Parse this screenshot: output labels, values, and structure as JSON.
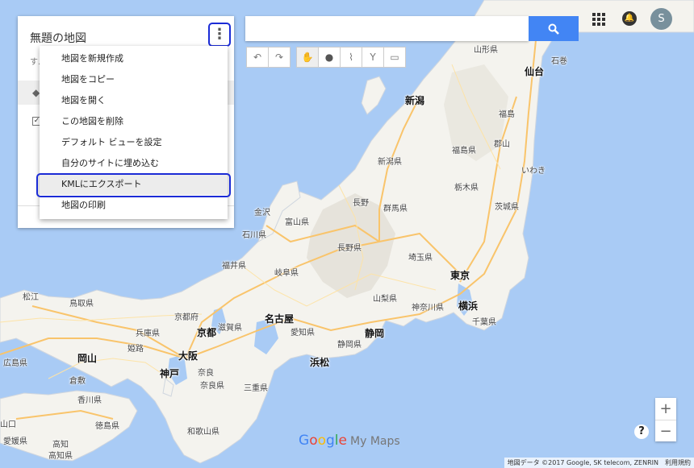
{
  "panel": {
    "title": "無題の地図",
    "subline": "す…"
  },
  "menu": {
    "items": [
      "地図を新規作成",
      "地図をコピー",
      "地図を開く",
      "この地図を削除",
      "デフォルト ビューを設定",
      "自分のサイトに埋め込む",
      "KMLにエクスポート",
      "地図の印刷"
    ],
    "selected_index": 6
  },
  "search": {
    "placeholder": ""
  },
  "avatar": {
    "initial": "S"
  },
  "zoom": {
    "in": "+",
    "out": "−"
  },
  "help": "?",
  "logo": {
    "google": [
      "G",
      "o",
      "o",
      "g",
      "l",
      "e"
    ],
    "product": "My Maps"
  },
  "attribution": "地図データ ©2017 Google, SK telecom, ZENRIN　利用規約",
  "colors": {
    "accent": "#4285f4",
    "highlight": "#1b2bd6",
    "sea": "#a9cbf5",
    "land": "#f4f3ee"
  },
  "map_labels": [
    {
      "text": "山形県",
      "cls": "lbl"
    },
    {
      "text": "石巻",
      "cls": "lbl"
    },
    {
      "text": "仙台",
      "cls": "lbl big"
    },
    {
      "text": "新潟",
      "cls": "lbl big"
    },
    {
      "text": "福島",
      "cls": "lbl"
    },
    {
      "text": "郡山",
      "cls": "lbl"
    },
    {
      "text": "福島県",
      "cls": "lbl"
    },
    {
      "text": "新潟県",
      "cls": "lbl"
    },
    {
      "text": "いわき",
      "cls": "lbl"
    },
    {
      "text": "栃木県",
      "cls": "lbl"
    },
    {
      "text": "茨城県",
      "cls": "lbl"
    },
    {
      "text": "長野",
      "cls": "lbl"
    },
    {
      "text": "群馬県",
      "cls": "lbl"
    },
    {
      "text": "金沢",
      "cls": "lbl"
    },
    {
      "text": "富山県",
      "cls": "lbl"
    },
    {
      "text": "石川県",
      "cls": "lbl"
    },
    {
      "text": "長野県",
      "cls": "lbl"
    },
    {
      "text": "埼玉県",
      "cls": "lbl"
    },
    {
      "text": "福井県",
      "cls": "lbl"
    },
    {
      "text": "岐阜県",
      "cls": "lbl"
    },
    {
      "text": "東京",
      "cls": "lbl big"
    },
    {
      "text": "山梨県",
      "cls": "lbl"
    },
    {
      "text": "神奈川県",
      "cls": "lbl"
    },
    {
      "text": "横浜",
      "cls": "lbl big"
    },
    {
      "text": "千葉県",
      "cls": "lbl"
    },
    {
      "text": "松江",
      "cls": "lbl"
    },
    {
      "text": "鳥取県",
      "cls": "lbl"
    },
    {
      "text": "京都府",
      "cls": "lbl"
    },
    {
      "text": "名古屋",
      "cls": "lbl big"
    },
    {
      "text": "兵庫県",
      "cls": "lbl"
    },
    {
      "text": "京都",
      "cls": "lbl big"
    },
    {
      "text": "滋賀県",
      "cls": "lbl"
    },
    {
      "text": "愛知県",
      "cls": "lbl"
    },
    {
      "text": "静岡",
      "cls": "lbl big"
    },
    {
      "text": "姫路",
      "cls": "lbl"
    },
    {
      "text": "静岡県",
      "cls": "lbl"
    },
    {
      "text": "広島県",
      "cls": "lbl"
    },
    {
      "text": "岡山",
      "cls": "lbl big"
    },
    {
      "text": "大阪",
      "cls": "lbl big"
    },
    {
      "text": "浜松",
      "cls": "lbl big"
    },
    {
      "text": "倉敷",
      "cls": "lbl"
    },
    {
      "text": "神戸",
      "cls": "lbl big"
    },
    {
      "text": "奈良",
      "cls": "lbl"
    },
    {
      "text": "奈良県",
      "cls": "lbl"
    },
    {
      "text": "三重県",
      "cls": "lbl"
    },
    {
      "text": "香川県",
      "cls": "lbl"
    },
    {
      "text": "山口",
      "cls": "lbl"
    },
    {
      "text": "徳島県",
      "cls": "lbl"
    },
    {
      "text": "和歌山県",
      "cls": "lbl"
    },
    {
      "text": "愛媛県",
      "cls": "lbl"
    },
    {
      "text": "高知",
      "cls": "lbl"
    },
    {
      "text": "高知県",
      "cls": "lbl"
    }
  ]
}
